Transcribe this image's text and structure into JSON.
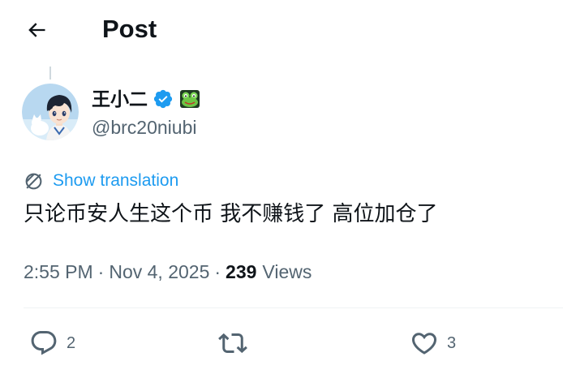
{
  "header": {
    "title": "Post",
    "back_icon": "arrow-left-icon"
  },
  "author": {
    "display_name": "王小二",
    "handle": "@brc20niubi",
    "verified_badge_color": "#1d9bf0",
    "emoji": "🐸",
    "avatar_icon": "avatar-anime-boy"
  },
  "tweet": {
    "translate_label": "Show translation",
    "text": "只论币安人生这个币 我不赚钱了 高位加仓了"
  },
  "meta": {
    "time": "2:55 PM",
    "separator": "·",
    "date": "Nov 4, 2025",
    "views_count": "239",
    "views_label": "Views"
  },
  "actions": {
    "reply_count": "2",
    "repost_count": "",
    "like_count": "3"
  },
  "colors": {
    "text_primary": "#0f1419",
    "text_secondary": "#536471",
    "accent": "#1d9bf0",
    "divider": "#eff3f4"
  }
}
